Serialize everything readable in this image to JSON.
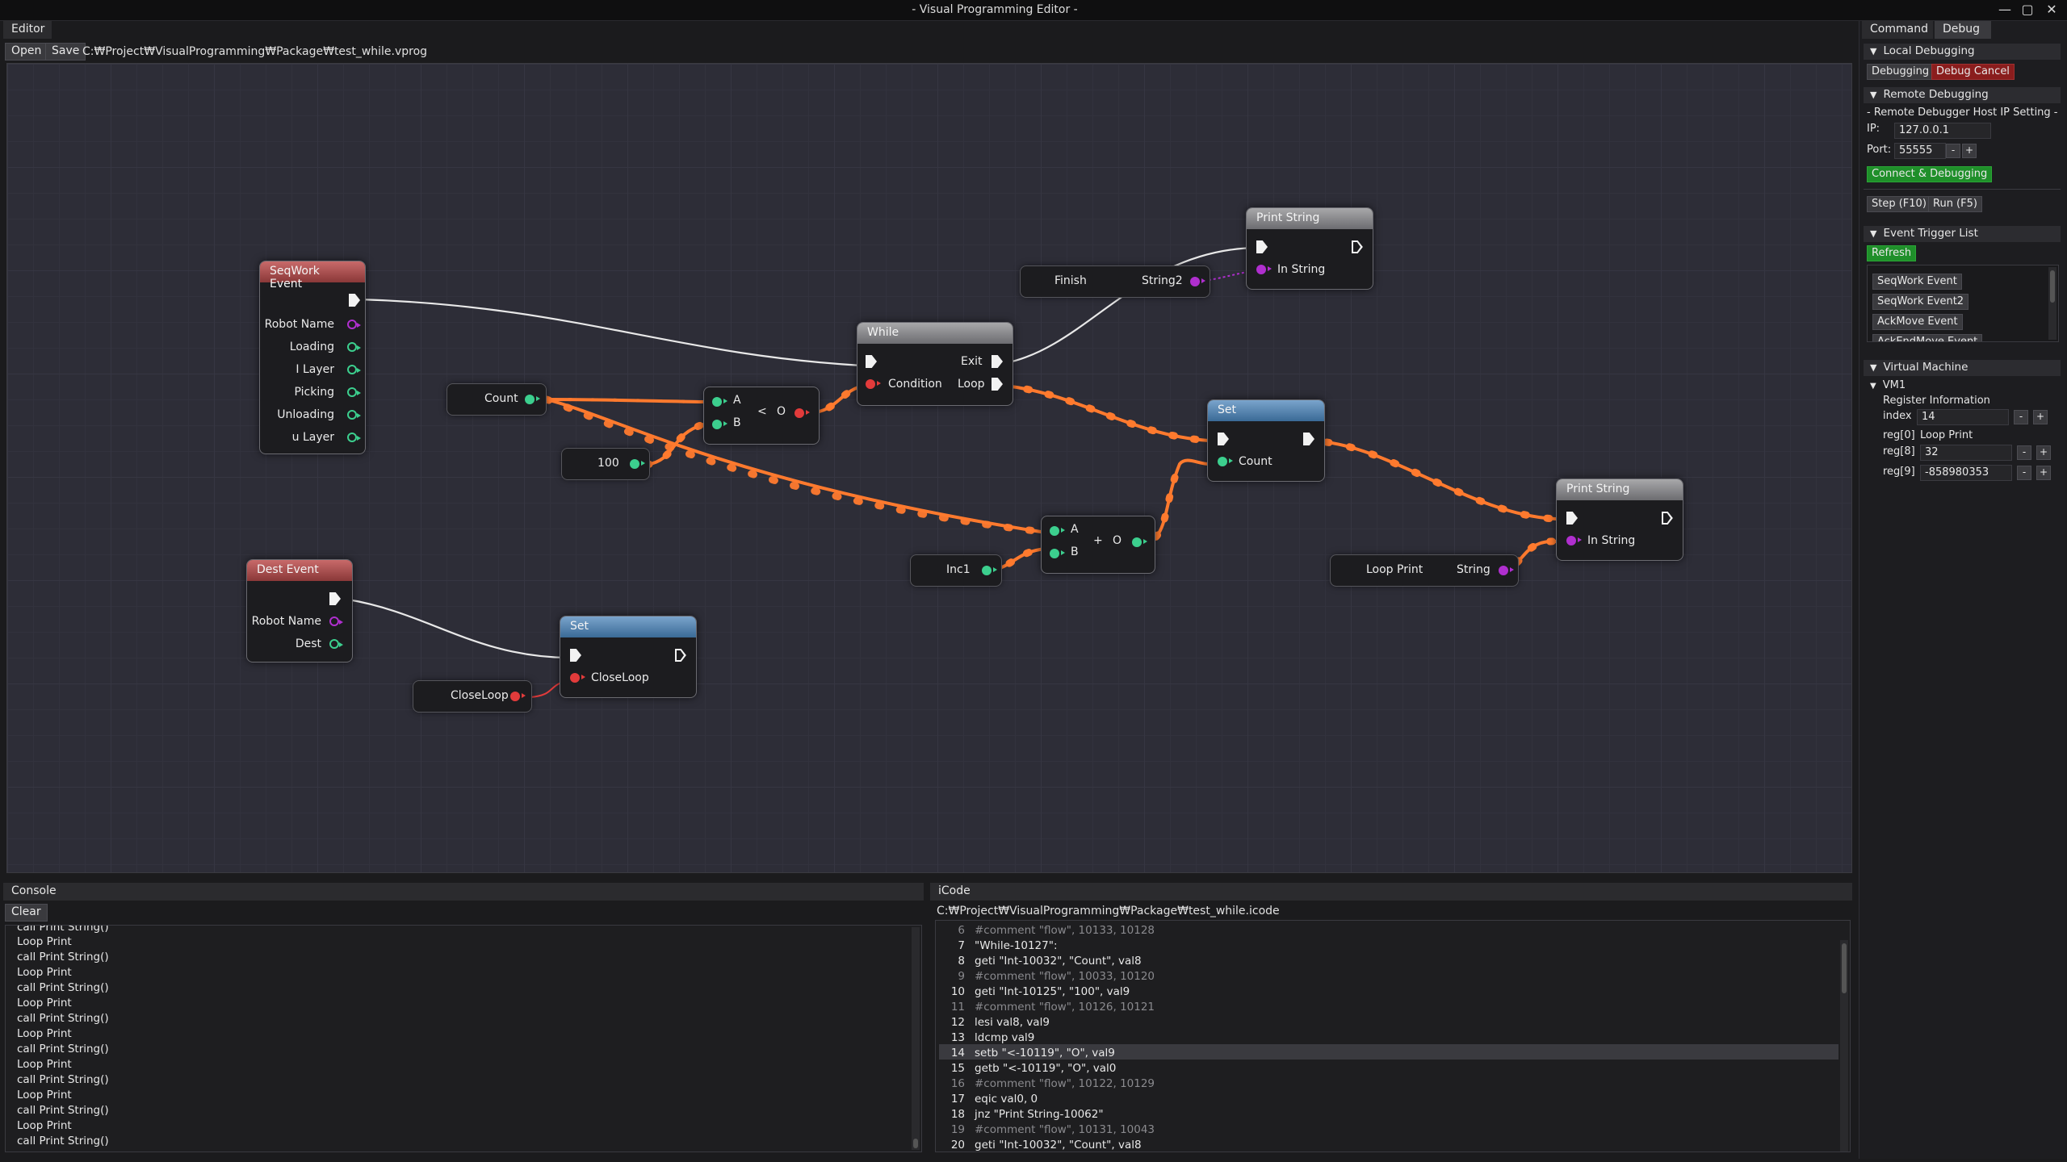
{
  "window": {
    "title": "- Visual Programming Editor -",
    "min": "—",
    "max": "▢",
    "close": "✕"
  },
  "editor": {
    "tab": "Editor",
    "open_label": "Open",
    "save_label": "Save",
    "path": "C:₩Project₩VisualProgramming₩Package₩test_while.vprog"
  },
  "nodes": {
    "seqwork": {
      "title": "SeqWork Event",
      "pins": [
        "Robot Name",
        "Loading",
        "I Layer",
        "Picking",
        "Unloading",
        "u Layer"
      ]
    },
    "dest": {
      "title": "Dest Event",
      "pins": [
        "Robot Name",
        "Dest"
      ]
    },
    "count_var": {
      "label": "Count"
    },
    "int100": {
      "label": "100"
    },
    "less": {
      "a": "A",
      "b": "B",
      "op": "<",
      "out": "O"
    },
    "while": {
      "title": "While",
      "exit": "Exit",
      "condition": "Condition",
      "loop": "Loop"
    },
    "finish": {
      "value": "Finish",
      "out": "String2"
    },
    "print1": {
      "title": "Print String",
      "in": "In String"
    },
    "set1": {
      "title": "Set",
      "in": "Count"
    },
    "add": {
      "a": "A",
      "b": "B",
      "op": "+",
      "out": "O"
    },
    "inc1": {
      "label": "Inc1"
    },
    "loopprint": {
      "value": "Loop Print",
      "out": "String"
    },
    "print2": {
      "title": "Print String",
      "in": "In String"
    },
    "set2": {
      "title": "Set",
      "in": "CloseLoop"
    },
    "closeloop": {
      "label": "CloseLoop"
    }
  },
  "console": {
    "tab": "Console",
    "clear_label": "Clear",
    "lines": [
      "call Print String()",
      "Loop Print",
      "call Print String()",
      "Loop Print",
      "call Print String()",
      "Loop Print",
      "call Print String()",
      "Loop Print",
      "call Print String()",
      "Loop Print",
      "call Print String()",
      "Loop Print",
      "call Print String()",
      "Loop Print",
      "call Print String()"
    ]
  },
  "icode": {
    "tab": "iCode",
    "path": "C:₩Project₩VisualProgramming₩Package₩test_while.icode",
    "highlight_line": 14,
    "lines": [
      {
        "n": "6",
        "t": "#comment \"flow\", 10133, 10128",
        "c": true
      },
      {
        "n": "7",
        "t": "\"While-10127\":",
        "c": false
      },
      {
        "n": "8",
        "t": "geti \"Int-10032\", \"Count\", val8",
        "c": false
      },
      {
        "n": "9",
        "t": "#comment \"flow\", 10033, 10120",
        "c": true
      },
      {
        "n": "10",
        "t": "geti \"Int-10125\", \"100\", val9",
        "c": false
      },
      {
        "n": "11",
        "t": "#comment \"flow\", 10126, 10121",
        "c": true
      },
      {
        "n": "12",
        "t": "lesi val8, val9",
        "c": false
      },
      {
        "n": "13",
        "t": "ldcmp val9",
        "c": false
      },
      {
        "n": "14",
        "t": "setb \"<-10119\", \"O\", val9",
        "c": false
      },
      {
        "n": "15",
        "t": "getb \"<-10119\", \"O\", val0",
        "c": false
      },
      {
        "n": "16",
        "t": "#comment \"flow\", 10122, 10129",
        "c": true
      },
      {
        "n": "17",
        "t": "eqic val0, 0",
        "c": false
      },
      {
        "n": "18",
        "t": "jnz \"Print String-10062\"",
        "c": false
      },
      {
        "n": "19",
        "t": "#comment \"flow\", 10131, 10043",
        "c": true
      },
      {
        "n": "20",
        "t": "geti \"Int-10032\", \"Count\", val8",
        "c": false
      }
    ]
  },
  "right": {
    "tab_command": "Command",
    "tab_debug": "Debug",
    "local_debugging": "Local Debugging",
    "debugging_btn": "Debugging",
    "debug_cancel_btn": "Debug Cancel",
    "remote_debugging": "Remote Debugging",
    "remote_host_setting": "- Remote Debugger Host IP Setting -",
    "ip_label": "IP:",
    "ip_value": "127.0.0.1",
    "port_label": "Port:",
    "port_value": "55555",
    "minus": "-",
    "plus": "+",
    "connect_btn": "Connect & Debugging",
    "step_btn": "Step (F10)",
    "run_btn": "Run (F5)",
    "event_trigger_list": "Event Trigger List",
    "refresh_btn": "Refresh",
    "events": [
      "SeqWork Event",
      "SeqWork Event2",
      "AckMove Event",
      "AckEndMove Event"
    ],
    "virtual_machine": "Virtual Machine",
    "vm1": "VM1",
    "register_information": "Register Information",
    "index_label": "index",
    "index_value": "14",
    "reg0_label": "reg[0]",
    "reg0_value": "Loop Print",
    "reg8_label": "reg[8]",
    "reg8_value": "32",
    "reg9_label": "reg[9]",
    "reg9_value": "-858980353"
  },
  "colors": {
    "accent_green": "#1f8f2a",
    "debug_cancel": "#8a1d1d",
    "wire_orange": "#ff7a2e",
    "wire_white": "#e8e8e8",
    "pin_green": "#3ccf8e",
    "pin_red": "#e23b3b",
    "pin_purple": "#b02fcf"
  }
}
